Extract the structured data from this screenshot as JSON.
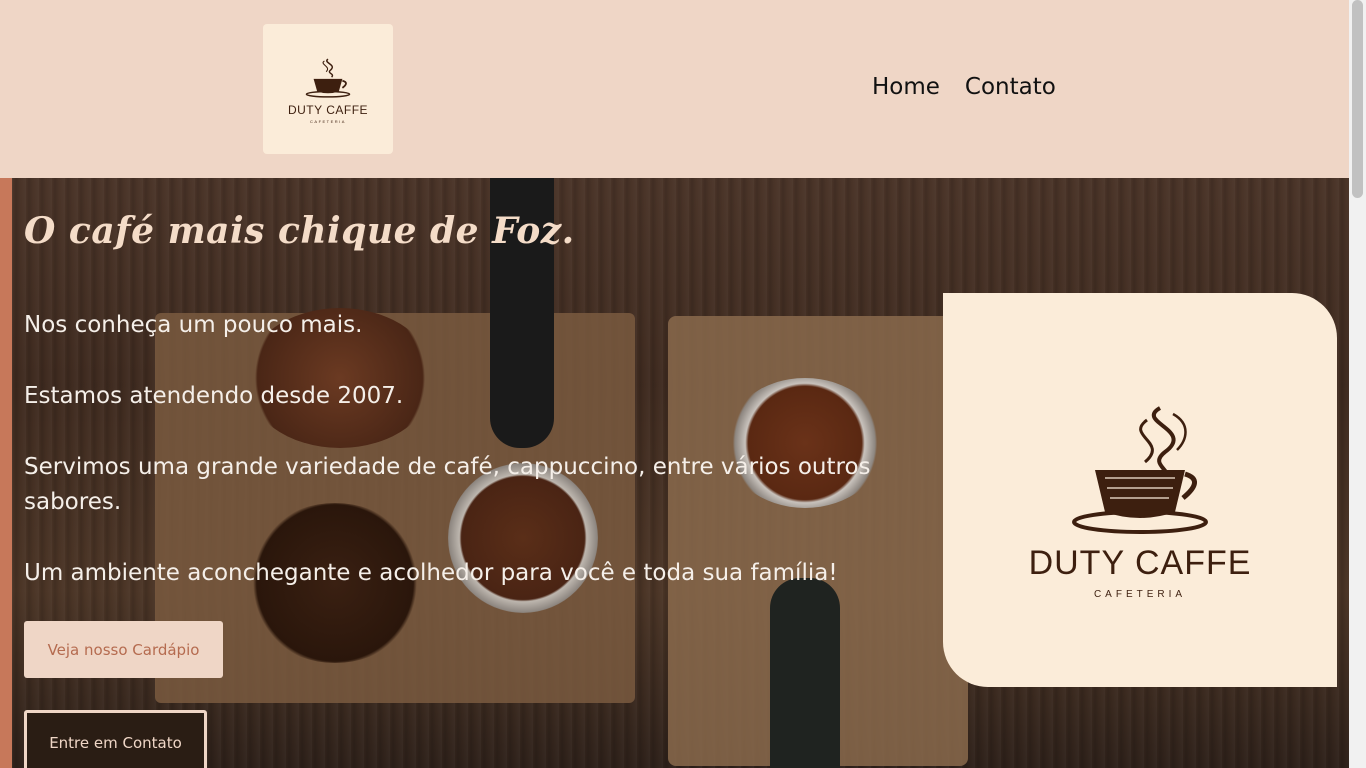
{
  "brand": {
    "logo_name": "DUTY CAFFE",
    "logo_subtitle": "CAFETERIA"
  },
  "nav": {
    "items": [
      {
        "label": "Home"
      },
      {
        "label": "Contato"
      }
    ]
  },
  "hero": {
    "tagline": "O café mais chique de Foz.",
    "paragraphs": [
      "Nos conheça um pouco mais.",
      "Estamos atendendo desde 2007.",
      "Servimos uma grande variedade de café, cappuccino, entre vários outros sabores.",
      "Um ambiente aconchegante e acolhedor para você e toda sua família!"
    ],
    "menu_button": "Veja nosso Cardápio",
    "contact_button": "Entre em Contato"
  },
  "colors": {
    "header_bg": "#efd6c6",
    "accent": "#c7785a",
    "logo_bg": "#fbecd9",
    "logo_ink": "#3d1f0f"
  },
  "icons": {
    "logo": "coffee-cup-steam-icon"
  }
}
